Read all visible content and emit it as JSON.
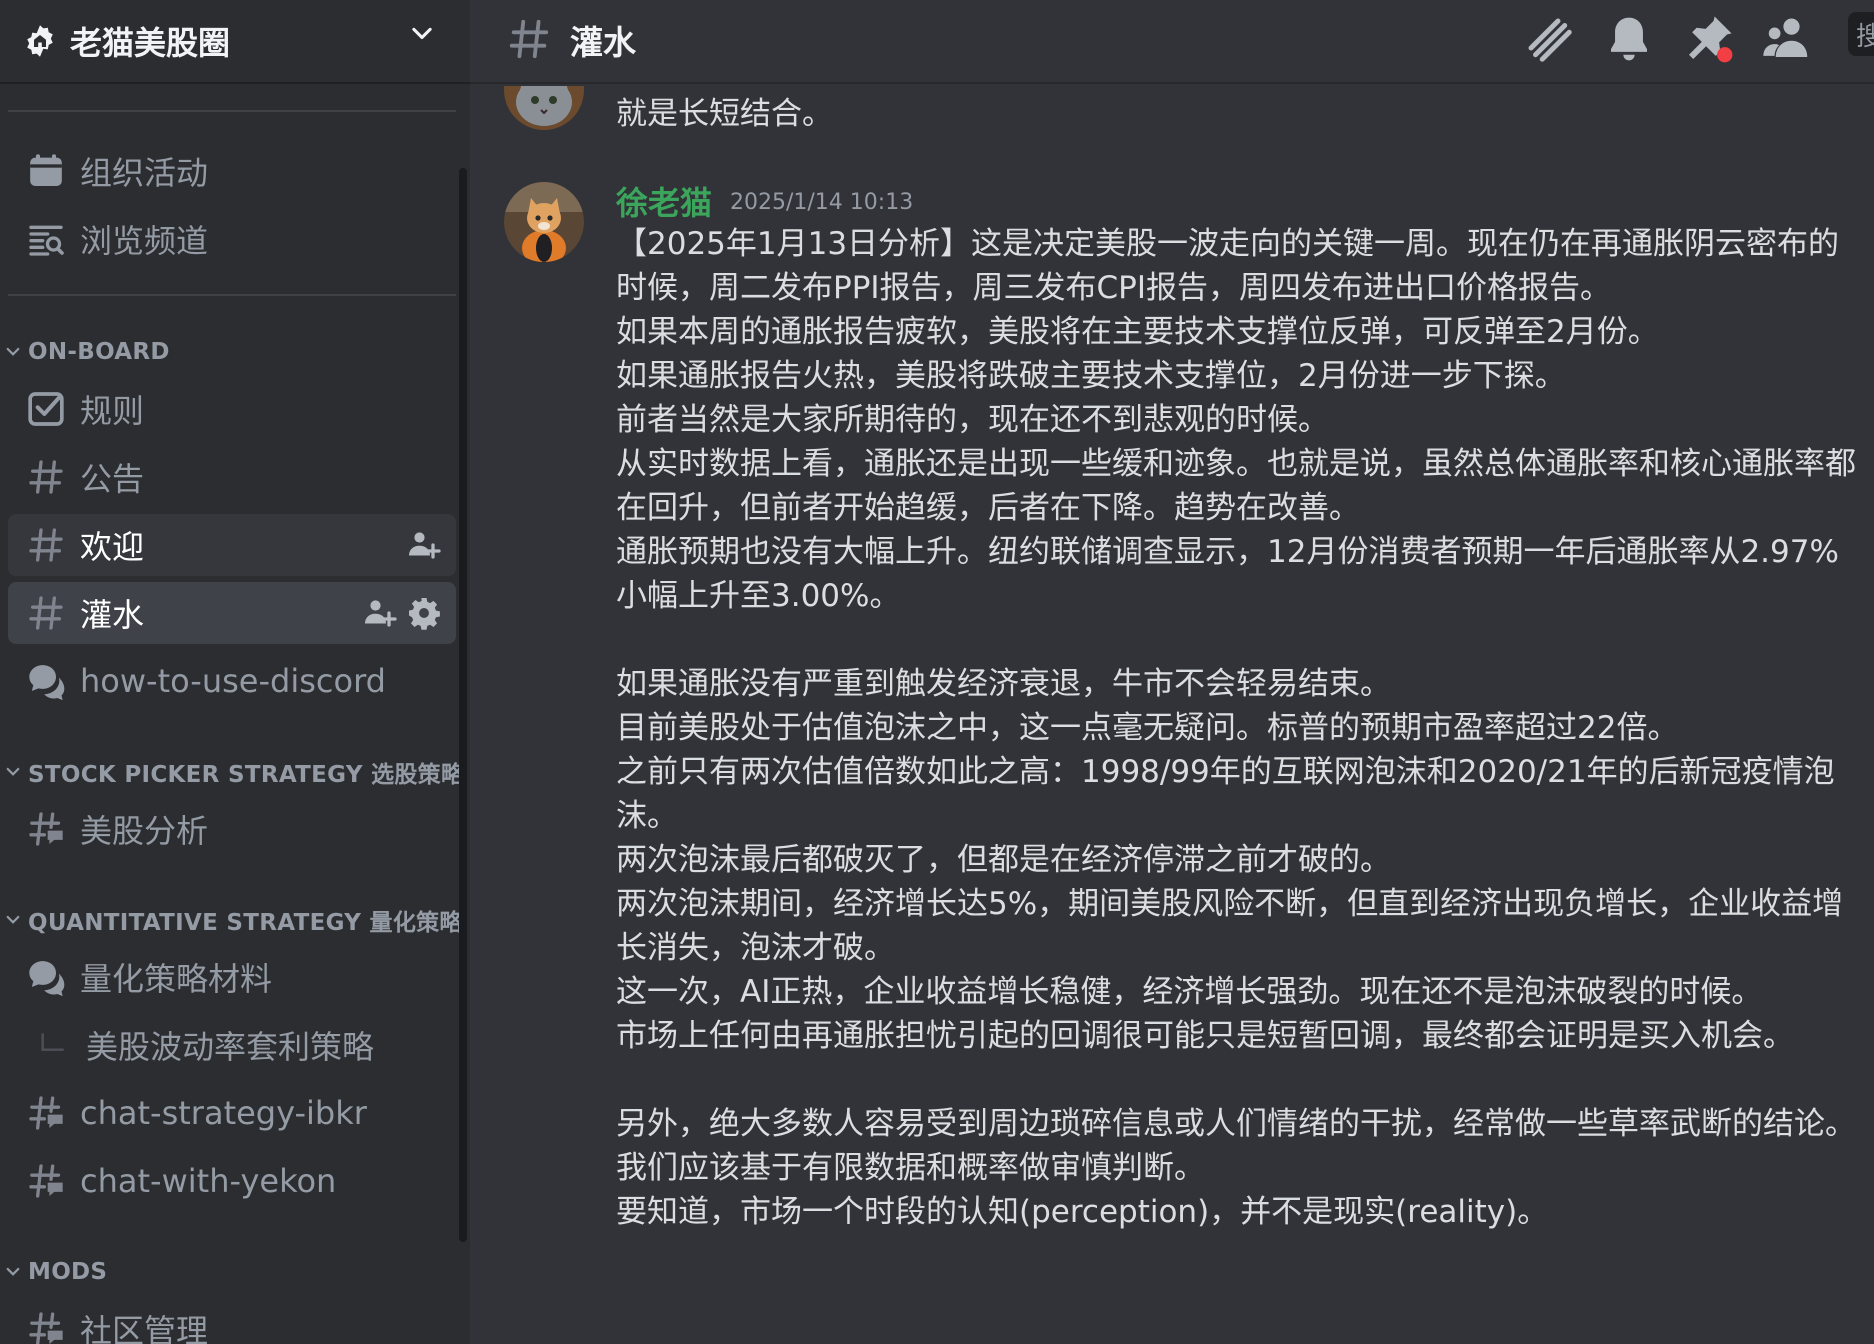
{
  "server": {
    "name": "老猫美股圈"
  },
  "nav": {
    "events": "组织活动",
    "browse": "浏览频道",
    "categories": {
      "onboard": "ON-BOARD",
      "stock_picker": "STOCK PICKER STRATEGY 选股策略",
      "quant": "QUANTITATIVE STRATEGY 量化策略",
      "mods": "MODS"
    },
    "channels": {
      "rules": "规则",
      "announce": "公告",
      "welcome": "欢迎",
      "chat": "灌水",
      "howto": "how-to-use-discord",
      "us_analysis": "美股分析",
      "quant_materials": "量化策略材料",
      "quant_thread": "美股波动率套利策略",
      "chat_ibkr": "chat-strategy-ibkr",
      "chat_yekon": "chat-with-yekon",
      "community": "社区管理"
    }
  },
  "header": {
    "channel": "灌水",
    "search_stub": "搜"
  },
  "messages": {
    "prev_tail": "就是长短结合。",
    "main": {
      "author": "徐老猫",
      "timestamp": "2025/1/14 10:13",
      "lines": [
        "【2025年1月13日分析】这是决定美股一波走向的关键一周。现在仍在再通胀阴云密布的时候，周二发布PPI报告，周三发布CPI报告，周四发布进出口价格报告。",
        "如果本周的通胀报告疲软，美股将在主要技术支撑位反弹，可反弹至2月份。",
        "如果通胀报告火热，美股将跌破主要技术支撑位，2月份进一步下探。",
        "前者当然是大家所期待的，现在还不到悲观的时候。",
        "从实时数据上看，通胀还是出现一些缓和迹象。也就是说，虽然总体通胀率和核心通胀率都在回升，但前者开始趋缓，后者在下降。趋势在改善。",
        "通胀预期也没有大幅上升。纽约联储调查显示，12月份消费者预期一年后通胀率从2.97%小幅上升至3.00%。",
        "",
        "如果通胀没有严重到触发经济衰退，牛市不会轻易结束。",
        "目前美股处于估值泡沫之中，这一点毫无疑问。标普的预期市盈率超过22倍。",
        "之前只有两次估值倍数如此之高：1998/99年的互联网泡沫和2020/21年的后新冠疫情泡沫。",
        "两次泡沫最后都破灭了，但都是在经济停滞之前才破的。",
        "两次泡沫期间，经济增长达5%，期间美股风险不断，但直到经济出现负增长，企业收益增长消失，泡沫才破。",
        "这一次，AI正热，企业收益增长稳健，经济增长强劲。现在还不是泡沫破裂的时候。",
        "市场上任何由再通胀担忧引起的回调很可能只是短暂回调，最终都会证明是买入机会。",
        "",
        "另外，绝大多数人容易受到周边琐碎信息或人们情绪的干扰，经常做一些草率武断的结论。",
        "我们应该基于有限数据和概率做审慎判断。",
        "要知道，市场一个时段的认知(perception)，并不是现实(reality)。"
      ]
    }
  },
  "icons": [
    "gear-icon",
    "chevron-down-icon",
    "calendar-icon",
    "browse-icon",
    "rules-icon",
    "hash-icon",
    "forum-icon",
    "threads-icon",
    "bell-icon",
    "pin-icon",
    "members-icon",
    "add-member-icon"
  ],
  "colors": {
    "accent_green": "#3ba55c",
    "notification_red": "#f23f43"
  }
}
